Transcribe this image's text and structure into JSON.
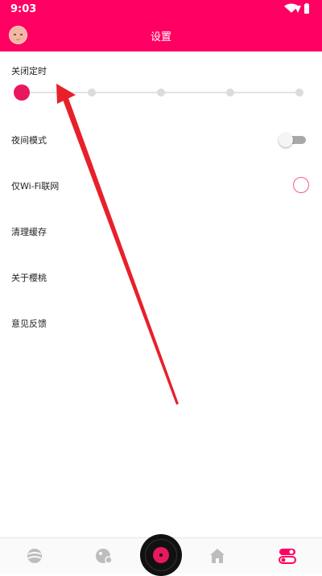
{
  "status_bar": {
    "time": "9:03"
  },
  "header": {
    "title": "设置"
  },
  "settings": {
    "timer_label": "关闭定时",
    "night_mode_label": "夜间模式",
    "wifi_only_label": "仅Wi-Fi联网",
    "clear_cache_label": "清理缓存",
    "about_label": "关于樱桃",
    "feedback_label": "意见反馈"
  },
  "timer": {
    "options_count": 5,
    "selected_index": 0
  },
  "toggles": {
    "night_mode_on": false,
    "wifi_only_on": false
  },
  "bottom_nav": {
    "items": [
      "discover-icon",
      "explore-icon",
      "now-playing-vinyl-icon",
      "home-icon",
      "settings-toggle-icon"
    ],
    "active": "settings-toggle-icon"
  },
  "colors": {
    "accent": "#ff0062",
    "active_dot": "#e8185e",
    "annotation_arrow": "#e8202a"
  }
}
